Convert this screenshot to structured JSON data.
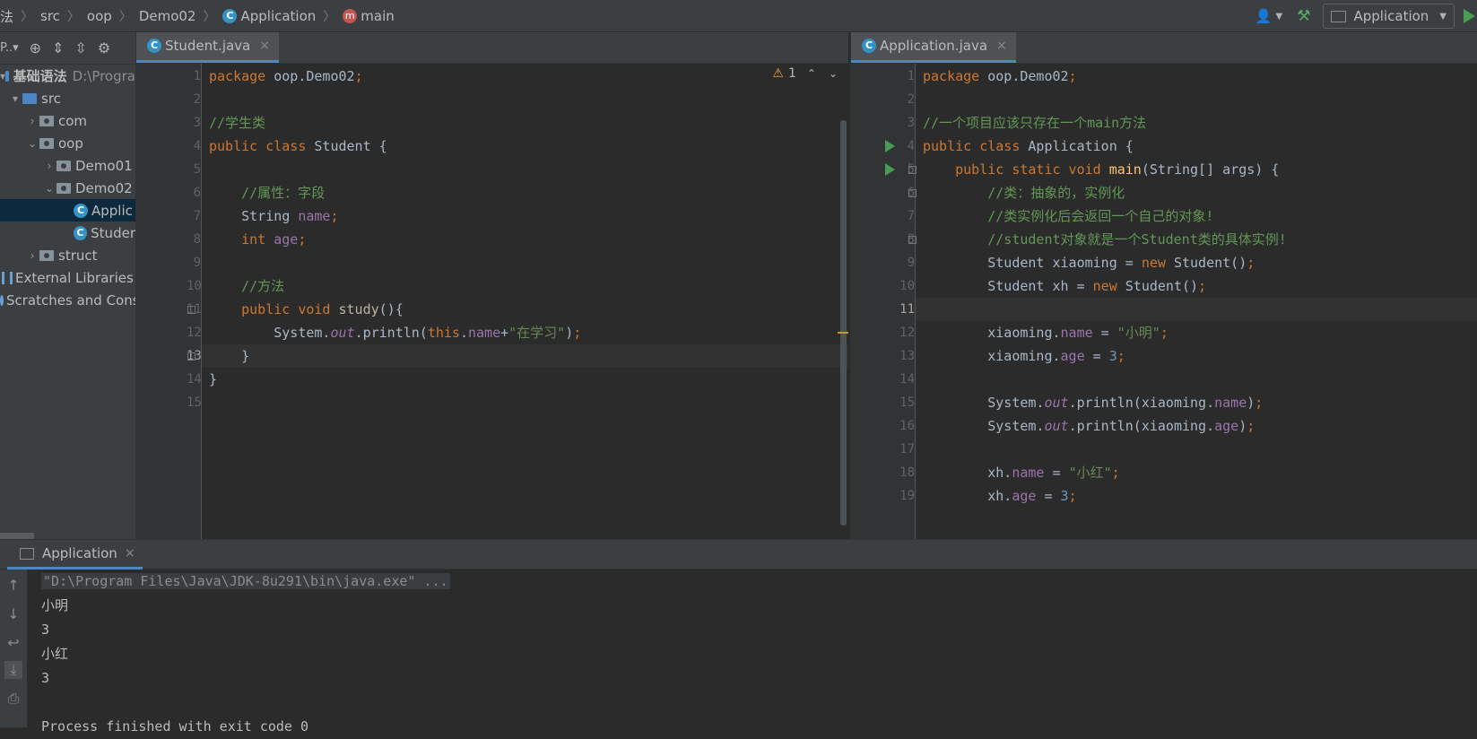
{
  "breadcrumb": {
    "root": "法",
    "items": [
      "src",
      "oop",
      "Demo02"
    ],
    "class_name": "Application",
    "method_name": "main"
  },
  "toolbar": {
    "run_config": "Application",
    "sidebar_tool_label": "P..▾"
  },
  "project_tree": [
    {
      "label": "基础语法",
      "path": "D:\\Progra",
      "indent": 0,
      "arrow": "▾",
      "icon": "folder-module",
      "selected": false
    },
    {
      "label": "src",
      "indent": 1,
      "arrow": "▾",
      "icon": "folder-source",
      "selected": false
    },
    {
      "label": "com",
      "indent": 2,
      "arrow": "›",
      "icon": "package",
      "selected": false
    },
    {
      "label": "oop",
      "indent": 2,
      "arrow": "⌄",
      "icon": "package",
      "selected": false
    },
    {
      "label": "Demo01",
      "indent": 3,
      "arrow": "›",
      "icon": "package",
      "selected": false
    },
    {
      "label": "Demo02",
      "indent": 3,
      "arrow": "⌄",
      "icon": "package",
      "selected": false
    },
    {
      "label": "Applic",
      "indent": 4,
      "arrow": "",
      "icon": "class-run",
      "selected": true
    },
    {
      "label": "Studer",
      "indent": 4,
      "arrow": "",
      "icon": "class",
      "selected": false
    },
    {
      "label": "struct",
      "indent": 2,
      "arrow": "›",
      "icon": "package",
      "selected": false
    },
    {
      "label": "External Libraries",
      "indent": 0,
      "arrow": "",
      "icon": "libraries",
      "selected": false
    },
    {
      "label": "Scratches and Cons",
      "indent": 0,
      "arrow": "",
      "icon": "scratches",
      "selected": false
    }
  ],
  "left_editor": {
    "tab": "Student.java",
    "inspection_count": "1",
    "current_line": 13,
    "lines": [
      [
        [
          "kw",
          "package "
        ],
        [
          "plain",
          "oop.Demo02"
        ],
        [
          "kw",
          ";"
        ]
      ],
      [],
      [
        [
          "cm",
          "//学生类"
        ]
      ],
      [
        [
          "kw",
          "public class "
        ],
        [
          "plain",
          "Student {"
        ]
      ],
      [],
      [
        [
          "plain",
          "    "
        ],
        [
          "cm",
          "//属性：字段"
        ]
      ],
      [
        [
          "plain",
          "    String "
        ],
        [
          "fld",
          "name"
        ],
        [
          "kw",
          ";"
        ]
      ],
      [
        [
          "plain",
          "    "
        ],
        [
          "kw",
          "int "
        ],
        [
          "fld",
          "age"
        ],
        [
          "kw",
          ";"
        ]
      ],
      [],
      [
        [
          "plain",
          "    "
        ],
        [
          "cm",
          "//方法"
        ]
      ],
      [
        [
          "plain",
          "    "
        ],
        [
          "kw",
          "public void "
        ],
        [
          "mu",
          "study"
        ],
        [
          "plain",
          "(){"
        ]
      ],
      [
        [
          "plain",
          "        System."
        ],
        [
          "st",
          "out"
        ],
        [
          "plain",
          ".println("
        ],
        [
          "kw",
          "this"
        ],
        [
          "plain",
          "."
        ],
        [
          "fld",
          "name"
        ],
        [
          "plain",
          "+"
        ],
        [
          "str",
          "\"在学习\""
        ],
        [
          "plain",
          ")"
        ],
        [
          "kw",
          ";"
        ]
      ],
      [
        [
          "plain",
          "    }"
        ]
      ],
      [
        [
          "plain",
          "}"
        ]
      ],
      []
    ]
  },
  "right_editor": {
    "tab": "Application.java",
    "current_line": 11,
    "lines": [
      [
        [
          "kw",
          "package "
        ],
        [
          "plain",
          "oop.Demo02"
        ],
        [
          "kw",
          ";"
        ]
      ],
      [],
      [
        [
          "cm",
          "//一个项目应该只存在一个main方法"
        ]
      ],
      [
        [
          "kw",
          "public class "
        ],
        [
          "plain",
          "Application {"
        ]
      ],
      [
        [
          "plain",
          "    "
        ],
        [
          "kw",
          "public static void "
        ],
        [
          "fn",
          "main"
        ],
        [
          "plain",
          "(String[] args) {"
        ]
      ],
      [
        [
          "plain",
          "        "
        ],
        [
          "cm",
          "//类：抽象的，实例化"
        ]
      ],
      [
        [
          "plain",
          "        "
        ],
        [
          "cm",
          "//类实例化后会返回一个自己的对象!"
        ]
      ],
      [
        [
          "plain",
          "        "
        ],
        [
          "cm",
          "//student对象就是一个Student类的具体实例!"
        ]
      ],
      [
        [
          "plain",
          "        Student xiaoming = "
        ],
        [
          "kw",
          "new "
        ],
        [
          "plain",
          "Student()"
        ],
        [
          "kw",
          ";"
        ]
      ],
      [
        [
          "plain",
          "        Student xh = "
        ],
        [
          "kw",
          "new "
        ],
        [
          "plain",
          "Student()"
        ],
        [
          "kw",
          ";"
        ]
      ],
      [],
      [
        [
          "plain",
          "        xiaoming."
        ],
        [
          "fld",
          "name"
        ],
        [
          "plain",
          " = "
        ],
        [
          "str",
          "\"小明\""
        ],
        [
          "kw",
          ";"
        ]
      ],
      [
        [
          "plain",
          "        xiaoming."
        ],
        [
          "fld",
          "age"
        ],
        [
          "plain",
          " = "
        ],
        [
          "num",
          "3"
        ],
        [
          "kw",
          ";"
        ]
      ],
      [],
      [
        [
          "plain",
          "        System."
        ],
        [
          "st",
          "out"
        ],
        [
          "plain",
          ".println(xiaoming."
        ],
        [
          "fld",
          "name"
        ],
        [
          "plain",
          ")"
        ],
        [
          "kw",
          ";"
        ]
      ],
      [
        [
          "plain",
          "        System."
        ],
        [
          "st",
          "out"
        ],
        [
          "plain",
          ".println(xiaoming."
        ],
        [
          "fld",
          "age"
        ],
        [
          "plain",
          ")"
        ],
        [
          "kw",
          ";"
        ]
      ],
      [],
      [
        [
          "plain",
          "        xh."
        ],
        [
          "fld",
          "name"
        ],
        [
          "plain",
          " = "
        ],
        [
          "str",
          "\"小红\""
        ],
        [
          "kw",
          ";"
        ]
      ],
      [
        [
          "plain",
          "        xh."
        ],
        [
          "fld",
          "age"
        ],
        [
          "plain",
          " = "
        ],
        [
          "num",
          "3"
        ],
        [
          "kw",
          ";"
        ]
      ]
    ]
  },
  "run_panel": {
    "tab": "Application",
    "output": [
      "\"D:\\Program Files\\Java\\JDK-8u291\\bin\\java.exe\" ...",
      "小明",
      "3",
      "小红",
      "3",
      "",
      "Process finished with exit code 0"
    ]
  },
  "colors": {
    "keyword": "#cc7832",
    "comment": "#629755",
    "string": "#6a8759",
    "field": "#9876aa",
    "number": "#6897bb",
    "method_decl": "#ffc66d",
    "accent": "#4a88c7",
    "run_green": "#499c54"
  }
}
